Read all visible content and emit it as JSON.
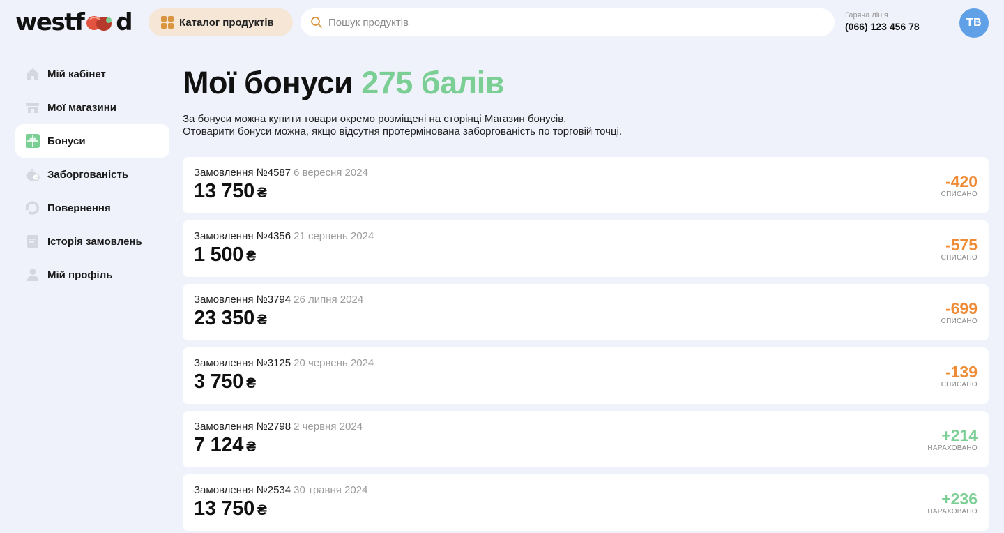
{
  "header": {
    "logo_left": "westf",
    "logo_right": "d",
    "catalog_label": "Каталог продуктів",
    "search_placeholder": "Пошук продуктів",
    "hotline_label": "Гаряча лінія",
    "hotline_phone": "(066) 123 456 78",
    "avatar_initials": "ТВ"
  },
  "sidebar": {
    "items": [
      {
        "label": "Мій кабінет",
        "icon": "home-icon",
        "active": false
      },
      {
        "label": "Мої магазини",
        "icon": "store-icon",
        "active": false
      },
      {
        "label": "Бонуси",
        "icon": "gift-icon",
        "active": true
      },
      {
        "label": "Заборгованість",
        "icon": "money-bag-icon",
        "active": false
      },
      {
        "label": "Повернення",
        "icon": "return-icon",
        "active": false
      },
      {
        "label": "Історія замовлень",
        "icon": "document-icon",
        "active": false
      },
      {
        "label": "Мій профіль",
        "icon": "user-icon",
        "active": false
      }
    ]
  },
  "main": {
    "title": "Мої бонуси",
    "points": "275 балів",
    "desc_line1": "За бонуси можна купити товари окремо розміщені на сторінці Магазин бонусів.",
    "desc_line2": "Отоварити бонуси можна, якщо відсутня протермінована заборгованість по торговій точці."
  },
  "orders": [
    {
      "title": "Замовлення №4587",
      "date": "6 вересня 2024",
      "sum": "13 750",
      "currency": "₴",
      "bonus": "-420",
      "status": "СПИСАНО",
      "type": "minus"
    },
    {
      "title": "Замовлення №4356",
      "date": "21 серпень 2024",
      "sum": "1 500",
      "currency": "₴",
      "bonus": "-575",
      "status": "СПИСАНО",
      "type": "minus"
    },
    {
      "title": "Замовлення №3794",
      "date": "26 липня 2024",
      "sum": "23 350",
      "currency": "₴",
      "bonus": "-699",
      "status": "СПИСАНО",
      "type": "minus"
    },
    {
      "title": "Замовлення №3125",
      "date": "20 червень 2024",
      "sum": "3 750",
      "currency": "₴",
      "bonus": "-139",
      "status": "СПИСАНО",
      "type": "minus"
    },
    {
      "title": "Замовлення №2798",
      "date": "2 червня 2024",
      "sum": "7 124",
      "currency": "₴",
      "bonus": "+214",
      "status": "НАРАХОВАНО",
      "type": "plus"
    },
    {
      "title": "Замовлення №2534",
      "date": "30 травня 2024",
      "sum": "13 750",
      "currency": "₴",
      "bonus": "+236",
      "status": "НАРАХОВАНО",
      "type": "plus"
    }
  ],
  "colors": {
    "accent_green": "#7bcf95",
    "accent_orange": "#ef8a35",
    "avatar_blue": "#5fa0e6",
    "catalog_bg": "#f5e6d6",
    "page_bg": "#f0f2fb"
  }
}
